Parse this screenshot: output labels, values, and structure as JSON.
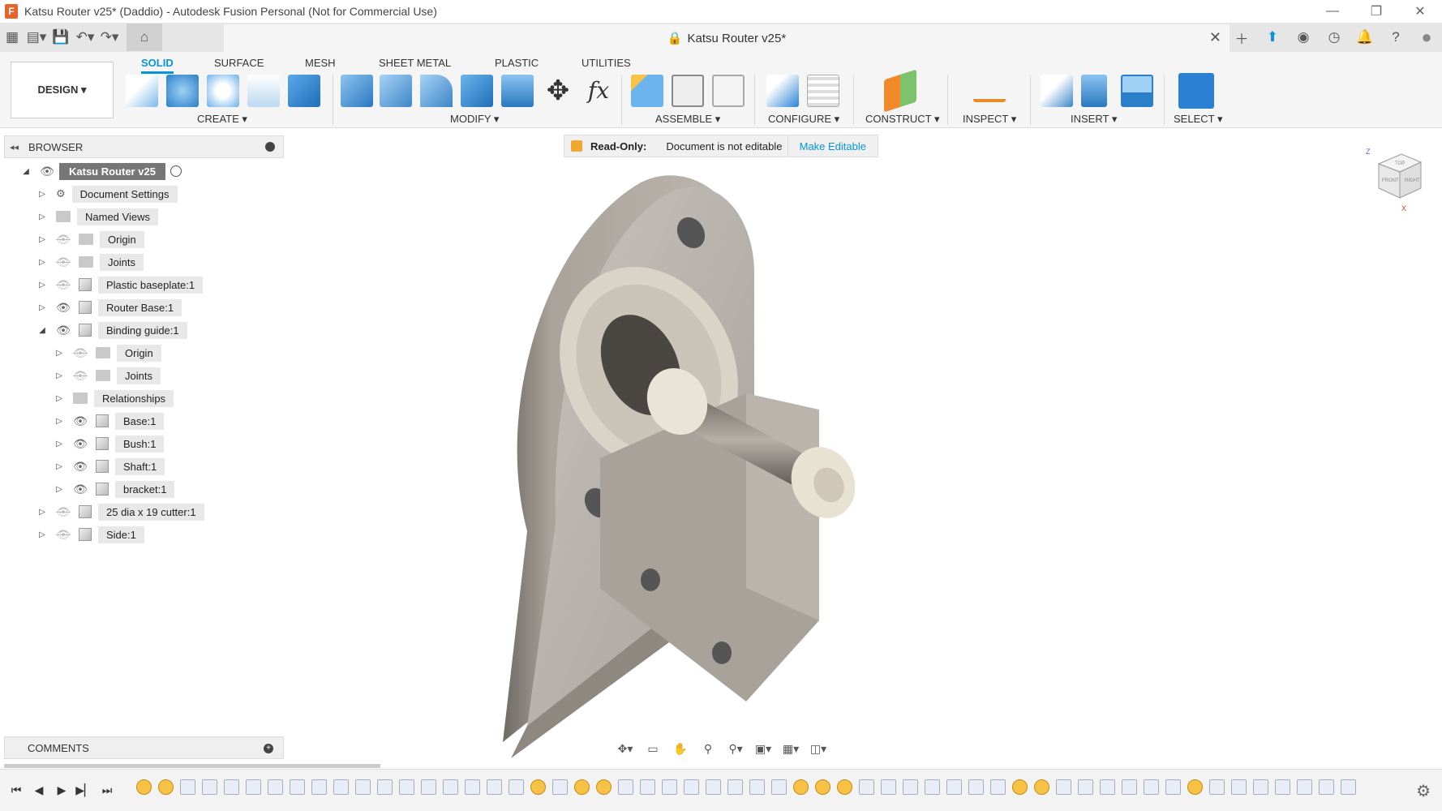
{
  "window": {
    "title": "Katsu Router v25* (Daddio) - Autodesk Fusion Personal (Not for Commercial Use)",
    "minimize": "—",
    "restore": "❐",
    "close": "✕"
  },
  "document_tab": {
    "title": "Katsu Router v25*",
    "close": "✕"
  },
  "workspace": {
    "label": "DESIGN ▾"
  },
  "tabs": [
    "SOLID",
    "SURFACE",
    "MESH",
    "SHEET METAL",
    "PLASTIC",
    "UTILITIES"
  ],
  "tool_groups": [
    "CREATE ▾",
    "MODIFY ▾",
    "ASSEMBLE ▾",
    "CONFIGURE ▾",
    "CONSTRUCT ▾",
    "INSPECT ▾",
    "INSERT ▾",
    "SELECT ▾"
  ],
  "banner": {
    "bold": "Read-Only:",
    "message": "Document is not editable",
    "action": "Make Editable"
  },
  "browser": {
    "title": "BROWSER",
    "root": "Katsu Router v25",
    "items": [
      {
        "label": "Document Settings"
      },
      {
        "label": "Named Views"
      },
      {
        "label": "Origin"
      },
      {
        "label": "Joints"
      },
      {
        "label": "Plastic baseplate:1"
      },
      {
        "label": "Router Base:1"
      },
      {
        "label": "Binding guide:1"
      },
      {
        "label": "Origin"
      },
      {
        "label": "Joints"
      },
      {
        "label": "Relationships"
      },
      {
        "label": "Base:1"
      },
      {
        "label": "Bush:1"
      },
      {
        "label": "Shaft:1"
      },
      {
        "label": "bracket:1"
      },
      {
        "label": "25 dia x 19 cutter:1"
      },
      {
        "label": "Side:1"
      }
    ]
  },
  "comments": {
    "title": "COMMENTS"
  },
  "viewcube": {
    "top": "TOP",
    "front": "FRONT",
    "right": "RIGHT",
    "z": "Z",
    "x": "X"
  }
}
